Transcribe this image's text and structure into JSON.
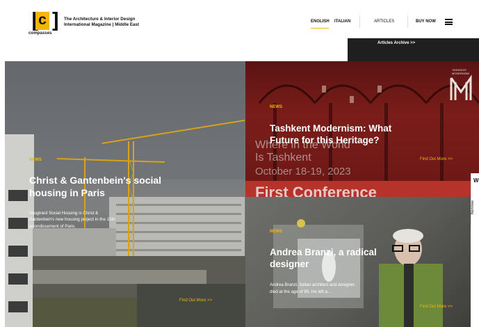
{
  "header": {
    "logo": {
      "bracket_left": "[",
      "letter": "c",
      "bracket_right": "]",
      "wordmark": "compasses"
    },
    "tagline_line1": "The Architecture & Interior Design",
    "tagline_line2": "International Magazine | Middle East",
    "languages": [
      "ENGLISH",
      "ITALIAN"
    ],
    "nav": {
      "articles": "ARTICLES",
      "buy_now": "BUY NOW",
      "menu_icon": "hamburger-icon"
    },
    "archive_link": "Articles Archive >>"
  },
  "tiles": {
    "left": {
      "tag": "NEWS",
      "title_line1": "Christ & Gantenbein's social",
      "title_line2": "housing in Paris",
      "excerpt_line1": "Vaugirard Social Housing is Christ &",
      "excerpt_line2": "Gantenbein's new housing project in the 15th",
      "excerpt_line3": "arrondissement of Paris.",
      "more": "Find Out More >>"
    },
    "top_right": {
      "poster": {
        "line1": "Where in the World",
        "line2": "Is Tashkent",
        "line3": "October 18-19, 2023",
        "line4": "First Conference",
        "corner_label_line1": "TASHKENT",
        "corner_label_line2": "MODERNISM"
      },
      "tag": "NEWS",
      "title_line1": "Tashkent Modernism: What",
      "title_line2": "Future for this Heritage?",
      "more": "Find Out More >>"
    },
    "bottom_right": {
      "tag": "NEWS",
      "title_line1": "Andrea Branzi, a radical",
      "title_line2": "designer",
      "excerpt_line1": "Andrea Branzi, Italian architect and designer,",
      "excerpt_line2": "died at the age of 85. He left a...",
      "more": "Find Out More >>"
    }
  },
  "side_tab": {
    "letter": "W",
    "label": "Nominee"
  },
  "colors": {
    "accent": "#f2b705",
    "header_bg": "#ffffff",
    "archive_bar": "#1f1f1f",
    "poster_red": "#b5332a"
  }
}
